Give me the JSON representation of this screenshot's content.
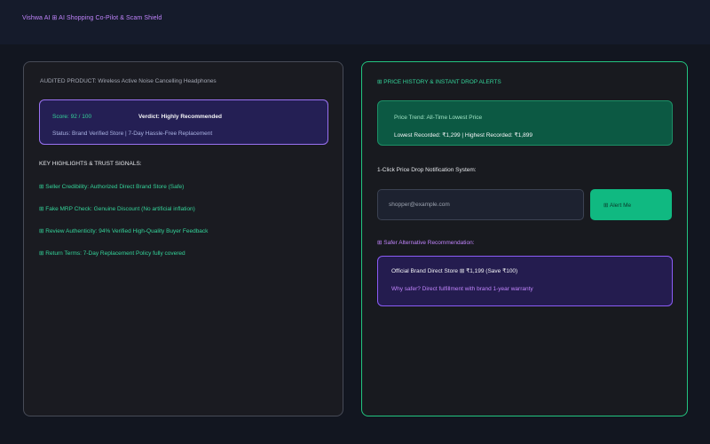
{
  "header": {
    "app_title": "Vishwa AI ⊞ AI Shopping Co-Pilot & Scam Shield"
  },
  "audit": {
    "product_line": "AUDITED PRODUCT: Wireless Active Noise Cancelling Headphones",
    "score": "Score: 92 / 100",
    "verdict": "Verdict: Highly Recommended",
    "status": "Status: Brand Verified Store  |  7-Day Hassle-Free Replacement",
    "highlights_heading": "KEY HIGHLIGHTS & TRUST SIGNALS:",
    "highlights": [
      "⊞ Seller Credibility: Authorized Direct Brand Store (Safe)",
      "⊞ Fake MRP Check: Genuine Discount (No artificial inflation)",
      "⊞ Review Authenticity: 94% Verified High-Quality Buyer Feedback",
      "⊞ Return Terms: 7-Day Replacement Policy fully covered"
    ]
  },
  "price": {
    "heading": "⊞ PRICE HISTORY & INSTANT DROP ALERTS",
    "trend": "Price Trend: All-Time Lowest Price",
    "recorded": "Lowest Recorded: ₹1,299  |  Highest Recorded: ₹1,899",
    "alert_heading": "1-Click Price Drop Notification System:",
    "email_placeholder": "shopper@example.com",
    "alert_button": "⊞ Alert Me",
    "safer_heading": "⊞ Safer Alternative Recommendation:",
    "official": "Official Brand Direct Store ⊞ ₹1,199 (Save ₹100)",
    "why": "Why safer? Direct fulfillment with brand 1-year warranty"
  },
  "colors": {
    "accent_green": "#10b981",
    "accent_purple": "#8b5cf6",
    "background": "#121620"
  }
}
